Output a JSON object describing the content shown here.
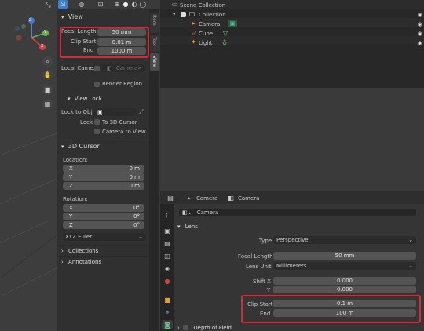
{
  "viewport": {
    "header": {
      "overlay_label": "",
      "gizmo_axes": {
        "y": "Y",
        "z": "Z",
        "x": "X"
      }
    }
  },
  "sidebar": {
    "tabs": [
      "Item",
      "Tool",
      "View"
    ],
    "view": {
      "title": "View",
      "focal_length_label": "Focal Length",
      "focal_length": "50 mm",
      "clip_start_label": "Clip Start",
      "clip_start": "0.01 m",
      "end_label": "End",
      "end": "1000 m",
      "local_camera_label": "Local Came...",
      "camera_placeholder": "Camera",
      "render_region_label": "Render Region"
    },
    "view_lock": {
      "title": "View Lock",
      "lock_to_object_label": "Lock to Obj...",
      "lock_label": "Lock",
      "to_3d_cursor": "To 3D Cursor",
      "camera_to_view": "Camera to View"
    },
    "cursor": {
      "title": "3D Cursor",
      "location_label": "Location:",
      "x": "0 m",
      "y": "0 m",
      "z": "0 m",
      "rotation_label": "Rotation:",
      "rx": "0°",
      "ry": "0°",
      "rz": "0°",
      "mode": "XYZ Euler"
    },
    "collections": "Collections",
    "annotations": "Annotations"
  },
  "outliner": {
    "scene_collection": "Scene Collection",
    "collection": "Collection",
    "items": [
      "Camera",
      "Cube",
      "Light"
    ]
  },
  "properties": {
    "header": {
      "object_name": "Camera",
      "data_name": "Camera"
    },
    "datablock": "Camera",
    "lens_title": "Lens",
    "type_label": "Type",
    "type": "Perspective",
    "focal_label": "Focal Length",
    "focal": "50 mm",
    "unit_label": "Lens Unit",
    "unit": "Millimeters",
    "shiftx_label": "Shift X",
    "shiftx": "0.000",
    "shifty_label": "Y",
    "shifty": "0.000",
    "clip_start_label": "Clip Start",
    "clip_start": "0.1 m",
    "end_label": "End",
    "end": "100 m",
    "dof_title": "Depth of Field"
  },
  "colors": {
    "highlight": "#d42b3b",
    "accent": "#3f7fd0",
    "camera_green": "#6fc199"
  }
}
